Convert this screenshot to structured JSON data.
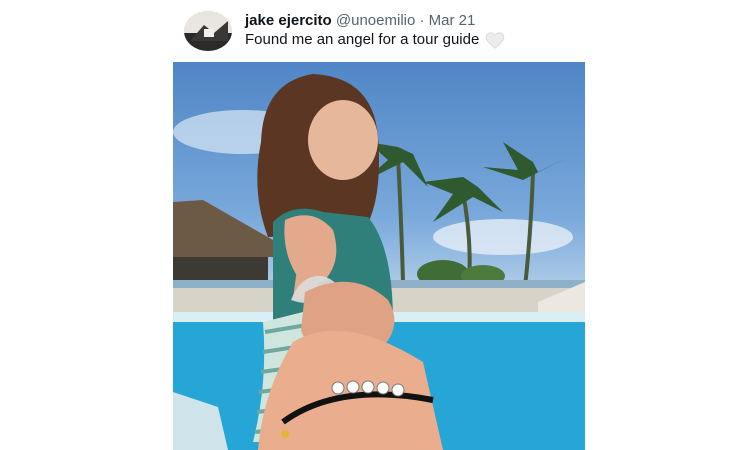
{
  "tweet": {
    "author_name": "jake ejercito",
    "handle": "@unoemilio",
    "separator": "·",
    "date": "Mar 21",
    "text": "Found me an angel for a tour guide",
    "like_icon": "heart-icon",
    "avatar_icon": "profile-photo"
  },
  "media": {
    "type": "photo"
  },
  "colors": {
    "text_primary": "#0f1419",
    "text_secondary": "#536471",
    "heart_outline": "#d5d5d5"
  }
}
